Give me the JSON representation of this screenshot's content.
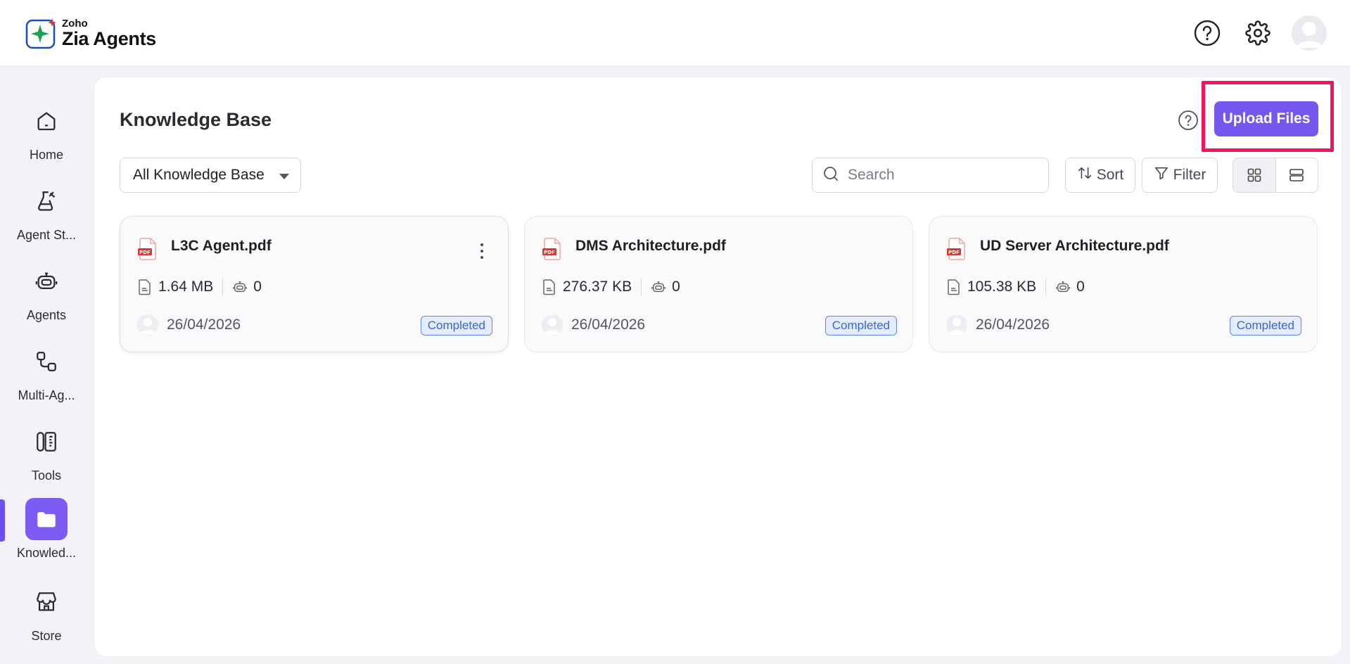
{
  "app": {
    "brand": "Zoho",
    "product": "Zia Agents"
  },
  "header": {
    "help_icon": "help-circle-icon",
    "settings_icon": "gear-icon",
    "avatar_icon": "user-avatar"
  },
  "sidebar": {
    "items": [
      {
        "label": "Home",
        "icon": "home-icon"
      },
      {
        "label": "Agent St...",
        "icon": "agent-studio-icon"
      },
      {
        "label": "Agents",
        "icon": "robot-icon"
      },
      {
        "label": "Multi-Ag...",
        "icon": "workflow-icon"
      },
      {
        "label": "Tools",
        "icon": "tools-icon"
      },
      {
        "label": "Knowled...",
        "icon": "folder-icon",
        "active": true
      },
      {
        "label": "Store",
        "icon": "store-icon"
      }
    ]
  },
  "main": {
    "title": "Knowledge Base",
    "upload_label": "Upload Files",
    "filter_select": "All Knowledge Base",
    "search_placeholder": "Search",
    "sort_label": "Sort",
    "filter_label": "Filter",
    "view_modes": [
      "grid",
      "list"
    ],
    "active_view": "grid"
  },
  "files": [
    {
      "name": "L3C Agent.pdf",
      "size": "1.64 MB",
      "agents": "0",
      "date": "26/04/2026",
      "status": "Completed"
    },
    {
      "name": "DMS Architecture.pdf",
      "size": "276.37 KB",
      "agents": "0",
      "date": "26/04/2026",
      "status": "Completed"
    },
    {
      "name": "UD Server Architecture.pdf",
      "size": "105.38 KB",
      "agents": "0",
      "date": "26/04/2026",
      "status": "Completed"
    }
  ],
  "colors": {
    "accent": "#7457ef",
    "highlight": "#f0155a",
    "badge": "#3766cf"
  }
}
